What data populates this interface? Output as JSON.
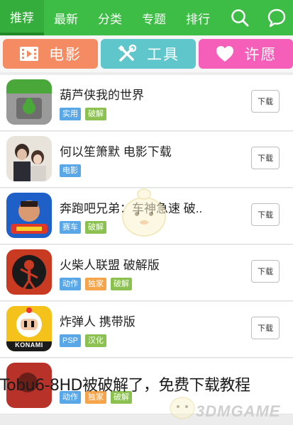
{
  "nav": {
    "tabs": [
      {
        "label": "推荐",
        "active": true
      },
      {
        "label": "最新",
        "active": false
      },
      {
        "label": "分类",
        "active": false
      },
      {
        "label": "专题",
        "active": false
      },
      {
        "label": "排行",
        "active": false
      }
    ],
    "icons": [
      "search-icon",
      "chat-icon"
    ]
  },
  "categories": [
    {
      "label": "电影",
      "icon": "film-icon",
      "color": "#f58b63"
    },
    {
      "label": "工具",
      "icon": "tools-icon",
      "color": "#5fc6cc"
    },
    {
      "label": "许愿",
      "icon": "heart-icon",
      "color": "#f55fb9"
    }
  ],
  "apps": [
    {
      "name": "葫芦侠我的世界",
      "tags": [
        {
          "text": "实用",
          "color": "#5aa7e8"
        },
        {
          "text": "破解",
          "color": "#8cc152"
        }
      ],
      "download": "下载"
    },
    {
      "name": "何以笙箫默  电影下载",
      "tags": [
        {
          "text": "电影",
          "color": "#5aa7e8"
        }
      ],
      "download": "下载"
    },
    {
      "name": "奔跑吧兄弟：车神急速  破..",
      "tags": [
        {
          "text": "赛车",
          "color": "#5aa7e8"
        },
        {
          "text": "破解",
          "color": "#8cc152"
        }
      ],
      "download": "下载"
    },
    {
      "name": "火柴人联盟  破解版",
      "tags": [
        {
          "text": "动作",
          "color": "#5aa7e8"
        },
        {
          "text": "独家",
          "color": "#f5a44a"
        },
        {
          "text": "破解",
          "color": "#8cc152"
        }
      ],
      "download": "下载"
    },
    {
      "name": "炸弹人  携带版",
      "tags": [
        {
          "text": "PSP",
          "color": "#5aa7e8"
        },
        {
          "text": "汉化",
          "color": "#8cc152"
        }
      ],
      "download": "下载"
    },
    {
      "name": "",
      "tags": [
        {
          "text": "动作",
          "color": "#5aa7e8"
        },
        {
          "text": "独家",
          "color": "#f5a44a"
        },
        {
          "text": "破解",
          "color": "#8cc152"
        }
      ],
      "download": ""
    }
  ],
  "overlay_caption": "Tobu6-8HD被破解了，免费下载教程",
  "icon_label_konami": "KONAMI",
  "watermark": "3DMGAME"
}
